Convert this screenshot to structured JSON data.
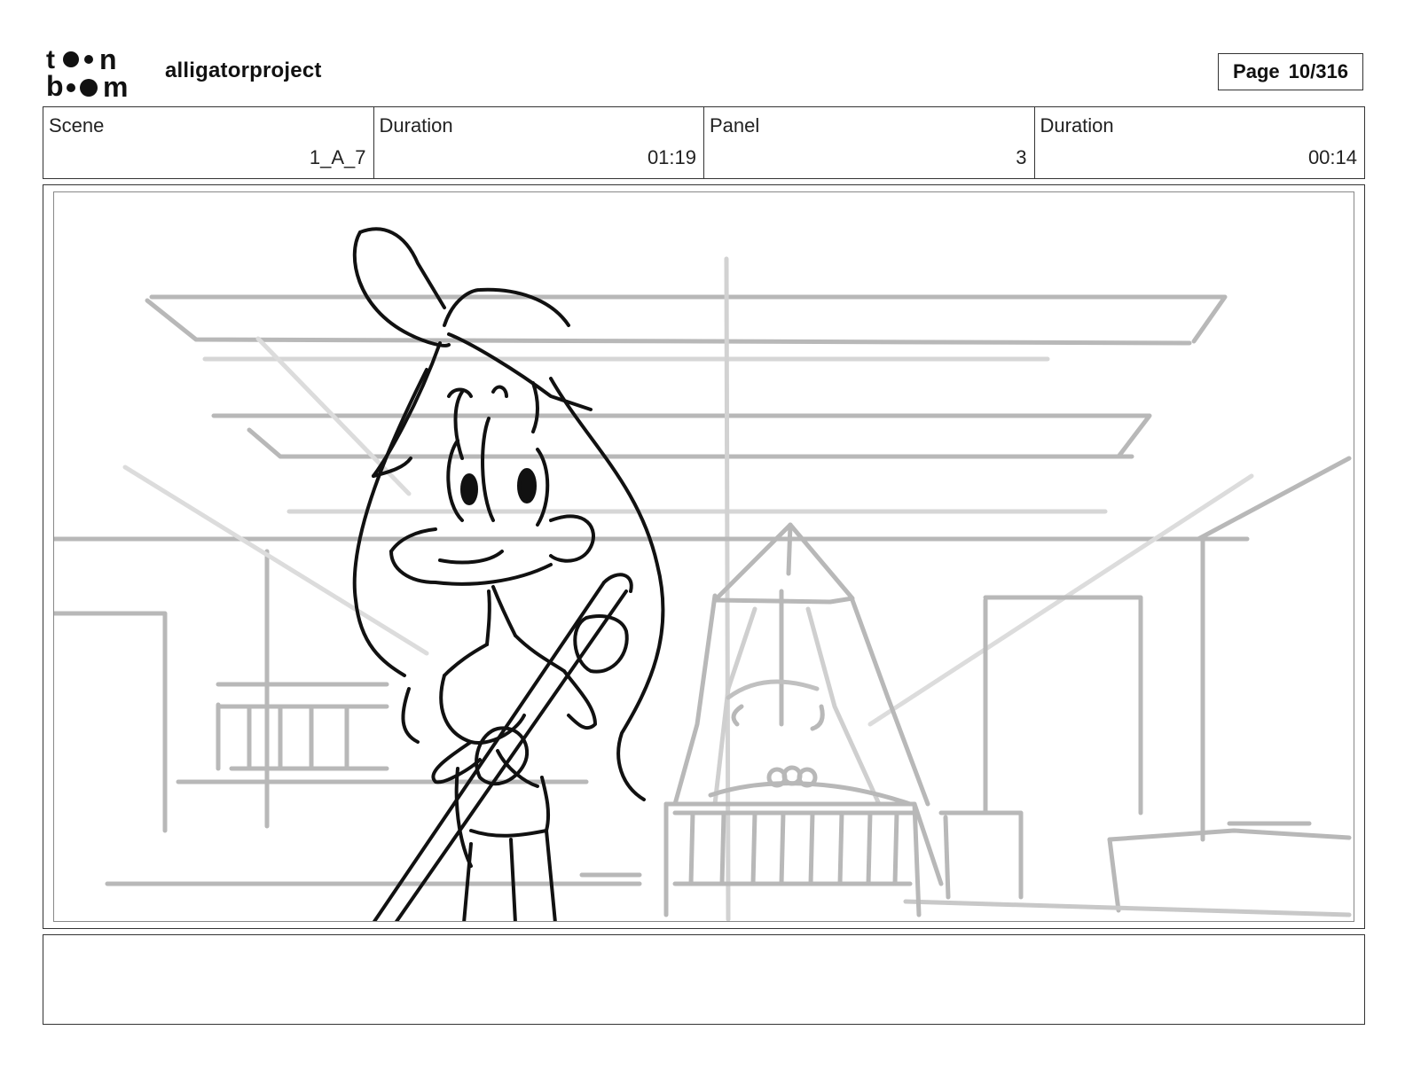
{
  "header": {
    "logo_text": "toon boom",
    "project_name": "alligatorproject",
    "page_label": "Page",
    "page_value": "10/316"
  },
  "info": [
    {
      "label": "Scene",
      "value": "1_A_7"
    },
    {
      "label": "Duration",
      "value": "01:19"
    },
    {
      "label": "Panel",
      "value": "3"
    },
    {
      "label": "Duration",
      "value": "00:14"
    }
  ],
  "notes": {
    "text": ""
  },
  "colors": {
    "border": "#333333",
    "sketch_dark": "#111111",
    "sketch_light": "#b5b5b5"
  }
}
